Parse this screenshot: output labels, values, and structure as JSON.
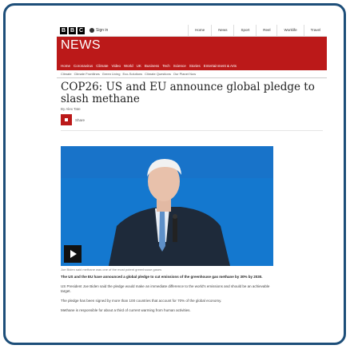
{
  "bbc": {
    "logo_letters": [
      "B",
      "B",
      "C"
    ],
    "signin": "Sign in",
    "top_nav": [
      "Home",
      "News",
      "Sport",
      "Reel",
      "Worklife",
      "Travel"
    ]
  },
  "news": {
    "title": "NEWS",
    "nav": [
      "Home",
      "Coronavirus",
      "Climate",
      "Video",
      "World",
      "UK",
      "Business",
      "Tech",
      "Science",
      "Stories",
      "Entertainment & Arts"
    ]
  },
  "subnav": [
    "Climate",
    "Climate Frontlines",
    "Green Living",
    "Eco-Solutions",
    "Climate Questions",
    "Our Planet Now"
  ],
  "article": {
    "headline": "COP26: US and EU announce global pledge to slash methane",
    "byline": "By Alex Tate",
    "share_label": "Share",
    "caption": "Joe Biden said methane was one of the most potent greenhouse gases",
    "paragraphs": [
      "The US and the EU have announced a global pledge to cut emissions of the greenhouse gas methane by 30% by 2030.",
      "US President Joe Biden said the pledge would make an immediate difference to the world's emissions and should be an achievable target.",
      "The pledge has been signed by more than 100 countries that account for 70% of the global economy.",
      "Methane is responsible for about a third of current warming from human activities."
    ]
  },
  "colors": {
    "frame_border": "#1d4e79",
    "bbc_red": "#bb1919",
    "video_bg": "#1581d6"
  }
}
